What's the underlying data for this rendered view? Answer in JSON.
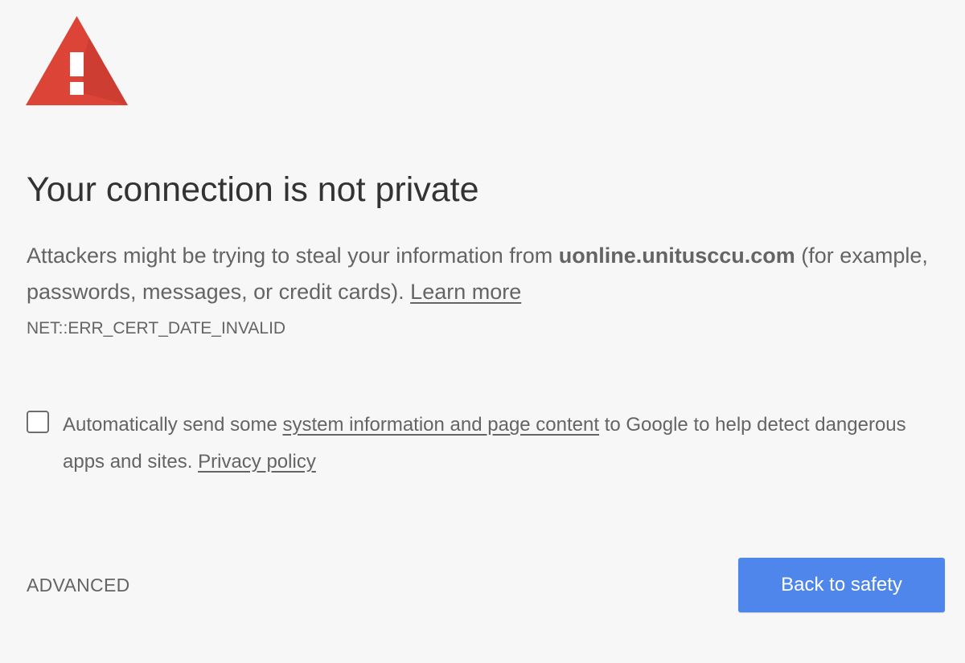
{
  "icon": "warning-triangle-icon",
  "colors": {
    "warning_red": "#db4437",
    "button_blue": "#4f86ec",
    "background": "#f7f7f7"
  },
  "title": "Your connection is not private",
  "message": {
    "before_domain": "Attackers might be trying to steal your information from ",
    "domain": "uonline.unitusccu.com",
    "after_domain": " (for example, passwords, messages, or credit cards). ",
    "learn_more": "Learn more"
  },
  "error_code": "NET::ERR_CERT_DATE_INVALID",
  "optin": {
    "checked": false,
    "before_link": "Automatically send some ",
    "link": "system information and page content",
    "after_link": " to Google to help detect dangerous apps and sites. ",
    "privacy_link": "Privacy policy"
  },
  "buttons": {
    "advanced": "ADVANCED",
    "back_to_safety": "Back to safety"
  }
}
